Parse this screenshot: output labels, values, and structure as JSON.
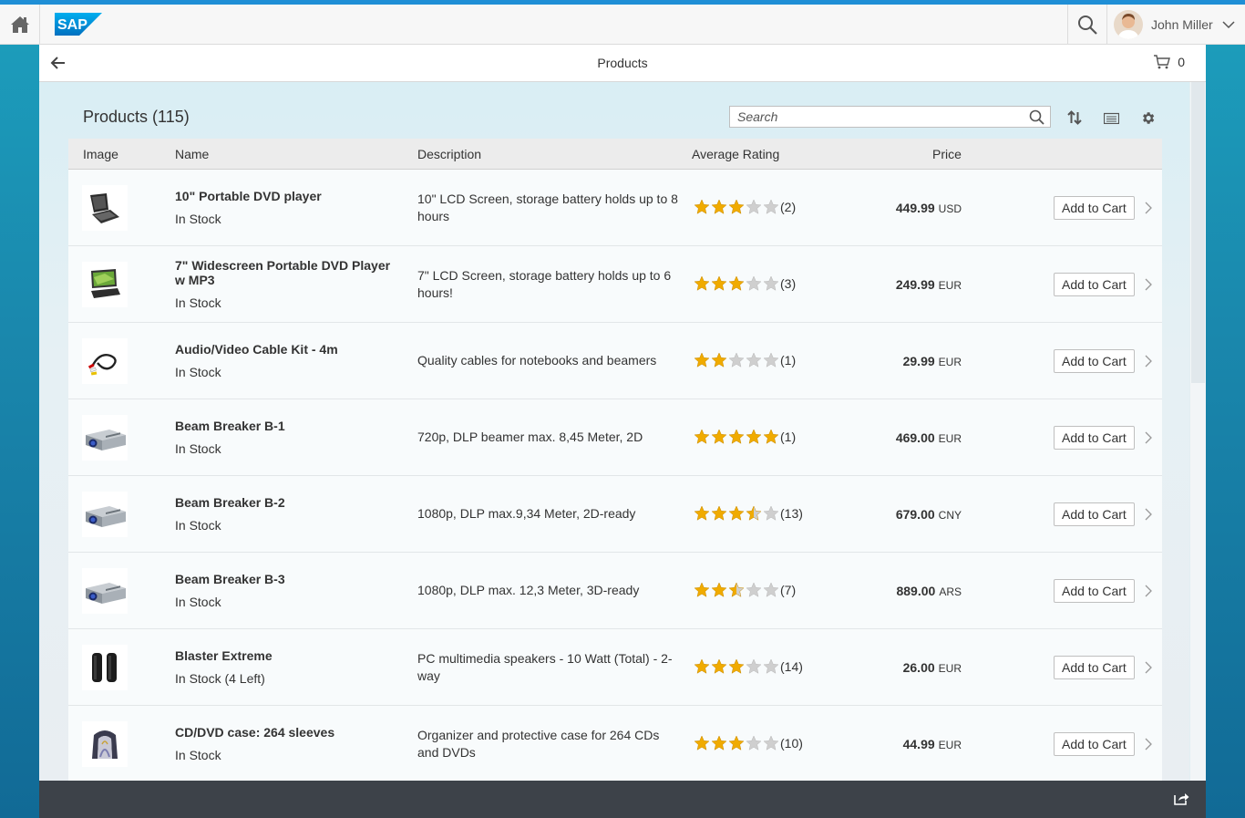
{
  "shell": {
    "logo_text": "SAP",
    "user_name": "John Miller"
  },
  "nav": {
    "title": "Products",
    "cart_count": "0"
  },
  "table": {
    "title": "Products (115)",
    "search_placeholder": "Search",
    "columns": [
      "Image",
      "Name",
      "Description",
      "Average Rating",
      "Price"
    ],
    "add_to_cart_label": "Add to Cart",
    "star_color": "#f0ab00",
    "empty_star_color": "#cfcfcf",
    "rows": [
      {
        "image": "portable-dvd-player",
        "name": "10\" Portable DVD player",
        "status": "In Stock",
        "description": "10\" LCD Screen, storage battery holds up to 8 hours",
        "rating": 3,
        "count": "(2)",
        "price": "449.99",
        "currency": "USD"
      },
      {
        "image": "widescreen-dvd-player",
        "name": "7\" Widescreen Portable DVD Player w MP3",
        "status": "In Stock",
        "description": "7\" LCD Screen, storage battery holds up to 6 hours!",
        "rating": 3,
        "count": "(3)",
        "price": "249.99",
        "currency": "EUR"
      },
      {
        "image": "av-cable-kit",
        "name": "Audio/Video Cable Kit - 4m",
        "status": "In Stock",
        "description": "Quality cables for notebooks and beamers",
        "rating": 2,
        "count": "(1)",
        "price": "29.99",
        "currency": "EUR"
      },
      {
        "image": "beamer-projector",
        "name": "Beam Breaker B-1",
        "status": "In Stock",
        "description": "720p, DLP beamer max. 8,45 Meter, 2D",
        "rating": 5,
        "count": "(1)",
        "price": "469.00",
        "currency": "EUR"
      },
      {
        "image": "beamer-projector",
        "name": "Beam Breaker B-2",
        "status": "In Stock",
        "description": "1080p, DLP max.9,34 Meter, 2D-ready",
        "rating": 3.5,
        "count": "(13)",
        "price": "679.00",
        "currency": "CNY"
      },
      {
        "image": "beamer-projector",
        "name": "Beam Breaker B-3",
        "status": "In Stock",
        "description": "1080p, DLP max. 12,3 Meter, 3D-ready",
        "rating": 2.5,
        "count": "(7)",
        "price": "889.00",
        "currency": "ARS"
      },
      {
        "image": "speakers",
        "name": "Blaster Extreme",
        "status": "In Stock (4 Left)",
        "description": "PC multimedia speakers - 10 Watt (Total) - 2-way",
        "rating": 3,
        "count": "(14)",
        "price": "26.00",
        "currency": "EUR"
      },
      {
        "image": "cd-case",
        "name": "CD/DVD case: 264 sleeves",
        "status": "In Stock",
        "description": "Organizer and protective case for 264 CDs and DVDs",
        "rating": 3,
        "count": "(10)",
        "price": "44.99",
        "currency": "EUR"
      }
    ]
  }
}
